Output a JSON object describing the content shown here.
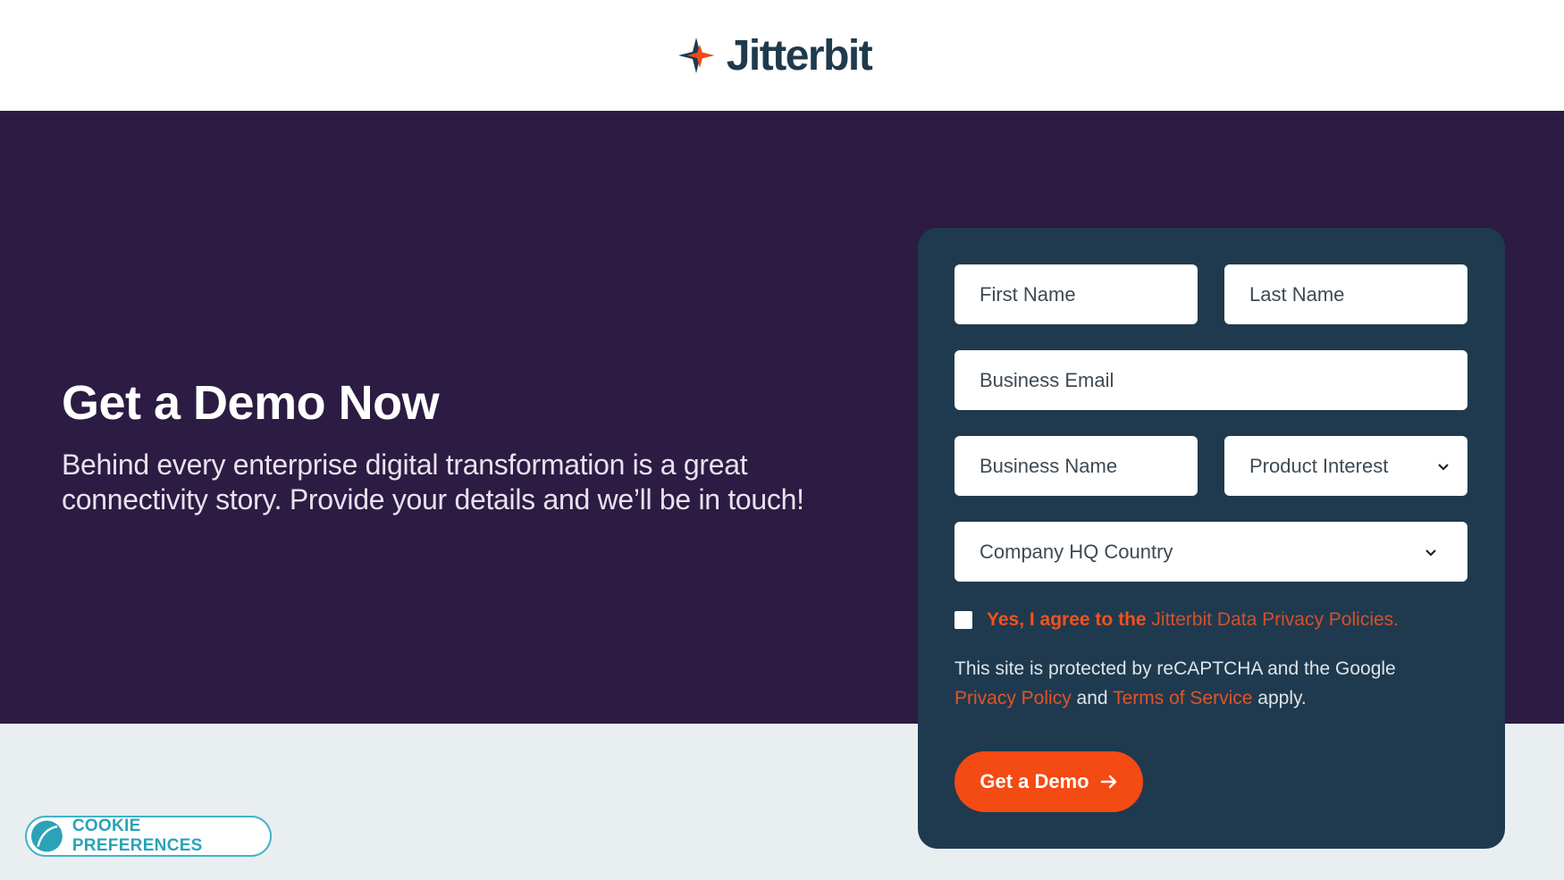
{
  "brand": {
    "name": "Jitterbit",
    "colors": {
      "navy": "#1e3a4c",
      "orange": "#f44a14",
      "hero_bg": "#2c1b42",
      "card_bg": "#1f3a4e",
      "cookie_teal": "#2aa3b8"
    }
  },
  "hero": {
    "title": "Get a Demo Now",
    "subtitle": "Behind every enterprise digital transformation is a great connectivity story. Provide your details and we’ll be in touch!"
  },
  "form": {
    "first_name_placeholder": "First Name",
    "last_name_placeholder": "Last Name",
    "email_placeholder": "Business Email",
    "business_name_placeholder": "Business Name",
    "product_interest_label": "Product Interest",
    "country_label": "Company HQ Country",
    "consent_prefix": "Yes, I agree to the ",
    "consent_link": "Jitterbit Data Privacy Policies.",
    "recaptcha_text": "This site is protected by reCAPTCHA and the Google",
    "privacy_link": "Privacy Policy",
    "and_text": "and",
    "terms_link": "Terms of Service",
    "apply_text": "apply.",
    "submit_label": "Get a Demo",
    "submit_icon": "arrow-right-icon",
    "dropdown_icon": "chevron-down-icon"
  },
  "cookie": {
    "label": "COOKIE PREFERENCES",
    "icon": "cookie-leaf-icon"
  }
}
